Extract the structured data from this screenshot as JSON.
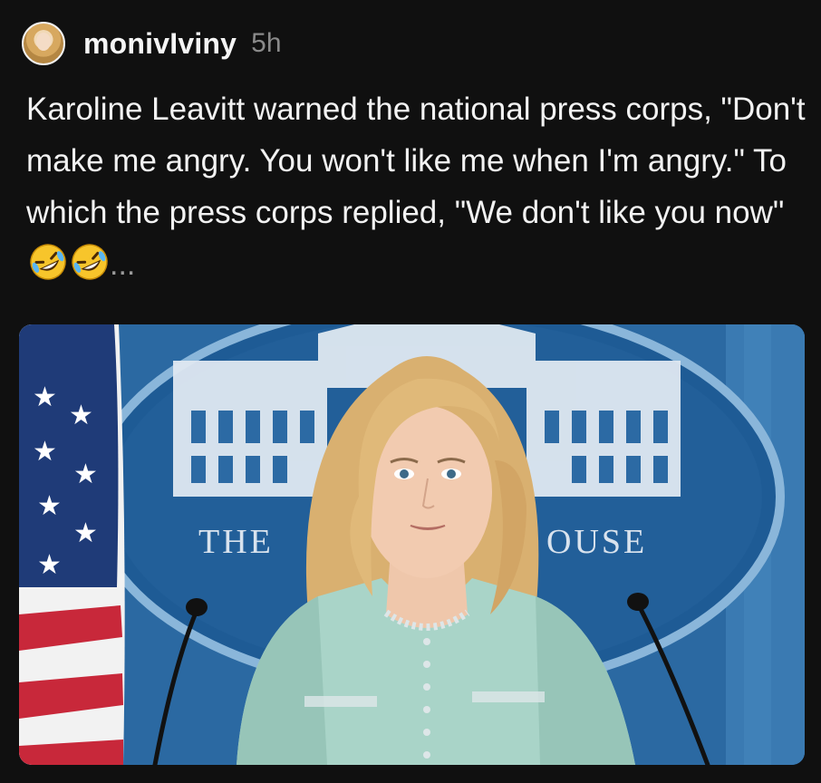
{
  "post": {
    "username": "monivIviny",
    "time": "5h",
    "text_before_emoji": "Karoline Leavitt warned the national press corps, \"Don't make me angry. You won't like me when I'm angry.\" To which the press corps replied, \"We don't like you now\" ",
    "emoji": [
      "rolling-on-floor-laughing-emoji",
      "rolling-on-floor-laughing-emoji"
    ],
    "ellipsis": "...",
    "image": {
      "seal_text_left": "THE",
      "seal_text_right": "OUSE",
      "colors": {
        "background": "#2f6da5",
        "seal": "#1f5d97",
        "jacket": "#a9d4c8",
        "hair": "#d9b070"
      }
    }
  }
}
